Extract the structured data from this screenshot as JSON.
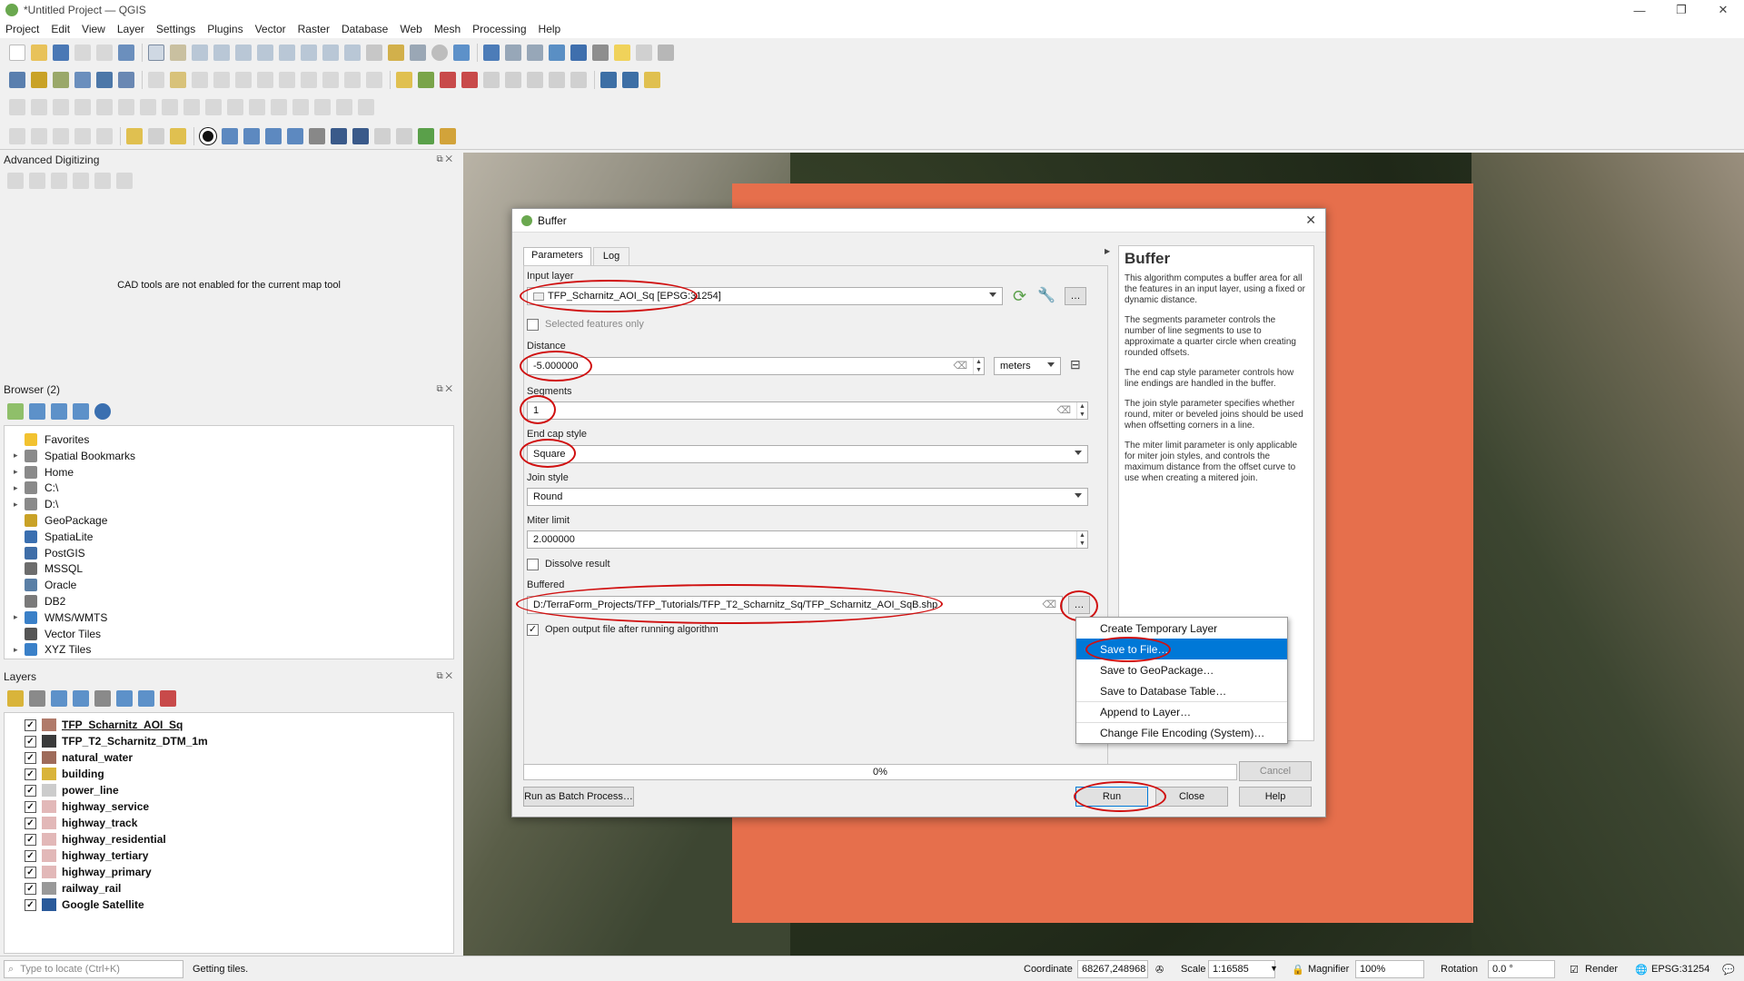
{
  "window": {
    "title": "*Untitled Project — QGIS",
    "controls": [
      "—",
      "❐",
      "✕"
    ]
  },
  "menu": [
    "Project",
    "Edit",
    "View",
    "Layer",
    "Settings",
    "Plugins",
    "Vector",
    "Raster",
    "Database",
    "Web",
    "Mesh",
    "Processing",
    "Help"
  ],
  "advanced_digitizing": {
    "title": "Advanced Digitizing",
    "message": "CAD tools are not enabled for the current map tool"
  },
  "browser": {
    "title": "Browser (2)",
    "items": [
      {
        "label": "Favorites",
        "icon": "star-icon",
        "color": "#f2c230",
        "expandable": false
      },
      {
        "label": "Spatial Bookmarks",
        "icon": "bookmark-icon",
        "color": "#8a8a8a",
        "expandable": true
      },
      {
        "label": "Home",
        "icon": "folder-icon",
        "color": "#8a8a8a",
        "expandable": true
      },
      {
        "label": "C:\\",
        "icon": "folder-icon",
        "color": "#8a8a8a",
        "expandable": true
      },
      {
        "label": "D:\\",
        "icon": "folder-icon",
        "color": "#8a8a8a",
        "expandable": true
      },
      {
        "label": "GeoPackage",
        "icon": "geopackage-icon",
        "color": "#c9a227",
        "expandable": false
      },
      {
        "label": "SpatiaLite",
        "icon": "feather-icon",
        "color": "#3a6fb0",
        "expandable": false
      },
      {
        "label": "PostGIS",
        "icon": "elephant-icon",
        "color": "#3f6ea8",
        "expandable": false
      },
      {
        "label": "MSSQL",
        "icon": "database-icon",
        "color": "#6d6d6d",
        "expandable": false
      },
      {
        "label": "Oracle",
        "icon": "database-icon",
        "color": "#5a7fa6",
        "expandable": false
      },
      {
        "label": "DB2",
        "icon": "database-icon",
        "color": "#7a7a7a",
        "expandable": false
      },
      {
        "label": "WMS/WMTS",
        "icon": "globe-icon",
        "color": "#3a80c8",
        "expandable": true
      },
      {
        "label": "Vector Tiles",
        "icon": "grid-icon",
        "color": "#555555",
        "expandable": false
      },
      {
        "label": "XYZ Tiles",
        "icon": "grid-icon",
        "color": "#3a80c8",
        "expandable": true
      }
    ]
  },
  "layers": {
    "title": "Layers",
    "items": [
      {
        "label": "TFP_Scharnitz_AOI_Sq",
        "swatch": "#b07a6a",
        "underline": true
      },
      {
        "label": "TFP_T2_Scharnitz_DTM_1m",
        "swatch": "#3a3a3a",
        "underline": false
      },
      {
        "label": "natural_water",
        "swatch": "#9e6b5a",
        "underline": false
      },
      {
        "label": "building",
        "swatch": "#d9b43a",
        "underline": false
      },
      {
        "label": "power_line",
        "swatch": "#cccccc",
        "underline": false
      },
      {
        "label": "highway_service",
        "swatch": "#e2b8b8",
        "underline": false
      },
      {
        "label": "highway_track",
        "swatch": "#e2b8b8",
        "underline": false
      },
      {
        "label": "highway_residential",
        "swatch": "#e2b8b8",
        "underline": false
      },
      {
        "label": "highway_tertiary",
        "swatch": "#e2b8b8",
        "underline": false
      },
      {
        "label": "highway_primary",
        "swatch": "#e2b8b8",
        "underline": false
      },
      {
        "label": "railway_rail",
        "swatch": "#999999",
        "underline": false
      },
      {
        "label": "Google Satellite",
        "swatch": "#2a5a9a",
        "underline": false
      }
    ]
  },
  "dialog": {
    "title": "Buffer",
    "tabs": [
      "Parameters",
      "Log"
    ],
    "input_layer_label": "Input layer",
    "input_layer_value": "TFP_Scharnitz_AOI_Sq [EPSG:31254]",
    "selected_only_label": "Selected features only",
    "distance_label": "Distance",
    "distance_value": "-5.000000",
    "distance_unit": "meters",
    "segments_label": "Segments",
    "segments_value": "1",
    "endcap_label": "End cap style",
    "endcap_value": "Square",
    "join_label": "Join style",
    "join_value": "Round",
    "miter_label": "Miter limit",
    "miter_value": "2.000000",
    "dissolve_label": "Dissolve result",
    "buffered_label": "Buffered",
    "buffered_value": "D:/TerraForm_Projects/TFP_Tutorials/TFP_T2_Scharnitz_Sq/TFP_Scharnitz_AOI_SqB.shp",
    "open_output_label": "Open output file after running algorithm",
    "progress": "0%",
    "buttons": {
      "batch": "Run as Batch Process…",
      "cancel": "Cancel",
      "run": "Run",
      "close": "Close",
      "help": "Help",
      "browse": "…"
    },
    "help": {
      "heading": "Buffer",
      "p1": "This algorithm computes a buffer area for all the features in an input layer, using a fixed or dynamic distance.",
      "p2": "The segments parameter controls the number of line segments to use to approximate a quarter circle when creating rounded offsets.",
      "p3": "The end cap style parameter controls how line endings are handled in the buffer.",
      "p4": "The join style parameter specifies whether round, miter or beveled joins should be used when offsetting corners in a line.",
      "p5": "The miter limit parameter is only applicable for miter join styles, and controls the maximum distance from the offset curve to use when creating a mitered join."
    }
  },
  "context_menu": [
    "Create Temporary Layer",
    "Save to File…",
    "Save to GeoPackage…",
    "Save to Database Table…",
    "Append to Layer…",
    "Change File Encoding (System)…"
  ],
  "status": {
    "locate_placeholder": "Type to locate (Ctrl+K)",
    "message": "Getting tiles.",
    "coordinate_label": "Coordinate",
    "coordinate": "68267,248968",
    "scale_label": "Scale",
    "scale": "1:16585",
    "magnifier_label": "Magnifier",
    "magnifier": "100%",
    "rotation_label": "Rotation",
    "rotation": "0.0 °",
    "render_label": "Render",
    "crs": "EPSG:31254"
  },
  "colors": {
    "aoi": "#e66f4c",
    "highlight": "#0078d7",
    "annotation": "#d01010"
  }
}
